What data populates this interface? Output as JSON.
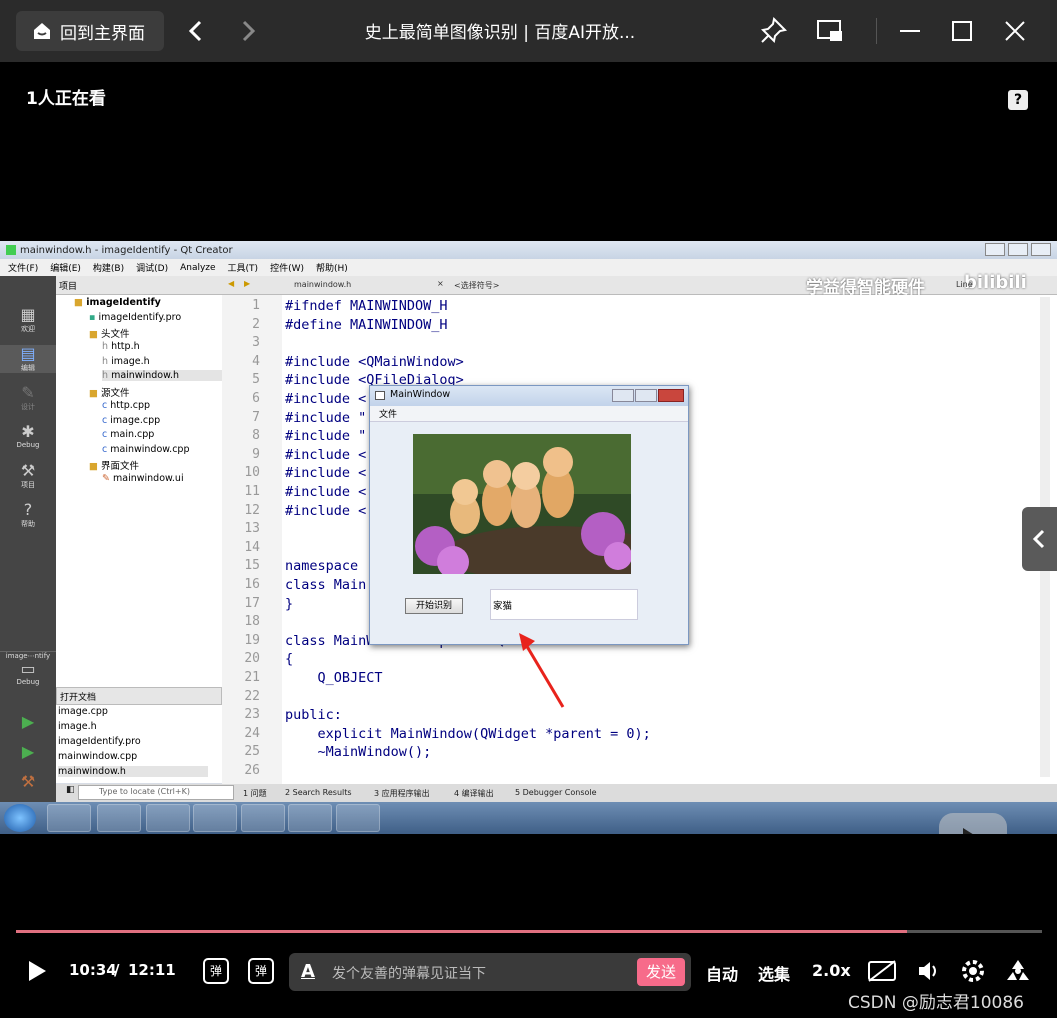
{
  "header": {
    "home_label": "回到主界面",
    "title": "史上最简单图像识别 | 百度AI开放..."
  },
  "viewer_count": "1人正在看",
  "video": {
    "window_title": "mainwindow.h - imageIdentify - Qt Creator",
    "menu": [
      "文件(F)",
      "编辑(E)",
      "构建(B)",
      "调试(D)",
      "Analyze",
      "工具(T)",
      "控件(W)",
      "帮助(H)"
    ],
    "modes": [
      "欢迎",
      "编辑",
      "设计",
      "Debug",
      "项目",
      "帮助"
    ],
    "kit_label": "image⋯ntify",
    "kit_debug": "Debug",
    "project_header": "项目",
    "tree": [
      {
        "label": "imageIdentify",
        "indent": 0,
        "bold": true
      },
      {
        "label": "imageIdentify.pro",
        "indent": 1
      },
      {
        "label": "头文件",
        "indent": 1
      },
      {
        "label": "http.h",
        "indent": 2
      },
      {
        "label": "image.h",
        "indent": 2
      },
      {
        "label": "mainwindow.h",
        "indent": 2
      },
      {
        "label": "源文件",
        "indent": 1
      },
      {
        "label": "http.cpp",
        "indent": 2
      },
      {
        "label": "image.cpp",
        "indent": 2
      },
      {
        "label": "main.cpp",
        "indent": 2
      },
      {
        "label": "mainwindow.cpp",
        "indent": 2
      },
      {
        "label": "界面文件",
        "indent": 1
      },
      {
        "label": "mainwindow.ui",
        "indent": 2
      }
    ],
    "open_docs_header": "打开文档",
    "open_docs": [
      "image.cpp",
      "image.h",
      "imageIdentify.pro",
      "mainwindow.cpp",
      "mainwindow.h"
    ],
    "editor_file": "mainwindow.h",
    "symbol_placeholder": "<选择符号>",
    "watermark": "学益得智能硬件",
    "bilibili": "bilibili",
    "line_hint": "Line",
    "code_lines": [
      {
        "n": "1",
        "t": "#ifndef MAINWINDOW_H"
      },
      {
        "n": "2",
        "t": "#define MAINWINDOW_H"
      },
      {
        "n": "3",
        "t": ""
      },
      {
        "n": "4",
        "t": "#include <QMainWindow>"
      },
      {
        "n": "5",
        "t": "#include <QFileDialog>"
      },
      {
        "n": "6",
        "t": "#include <"
      },
      {
        "n": "7",
        "t": "#include \""
      },
      {
        "n": "8",
        "t": "#include \""
      },
      {
        "n": "9",
        "t": "#include <"
      },
      {
        "n": "10",
        "t": "#include <"
      },
      {
        "n": "11",
        "t": "#include <"
      },
      {
        "n": "12",
        "t": "#include <"
      },
      {
        "n": "13",
        "t": ""
      },
      {
        "n": "14",
        "t": ""
      },
      {
        "n": "15",
        "t": "namespace"
      },
      {
        "n": "16",
        "t": "class Main"
      },
      {
        "n": "17",
        "t": "}"
      },
      {
        "n": "18",
        "t": ""
      },
      {
        "n": "19",
        "t": "class MainWindow : public QMainWindow"
      },
      {
        "n": "20",
        "t": "{"
      },
      {
        "n": "21",
        "t": "    Q_OBJECT"
      },
      {
        "n": "22",
        "t": ""
      },
      {
        "n": "23",
        "t": "public:"
      },
      {
        "n": "24",
        "t": "    explicit MainWindow(QWidget *parent = 0);"
      },
      {
        "n": "25",
        "t": "    ~MainWindow();"
      },
      {
        "n": "26",
        "t": ""
      }
    ],
    "app_window": {
      "title": "MainWindow",
      "menu": "文件",
      "button": "开始识别",
      "result": "家猫"
    },
    "locate_placeholder": "Type to locate (Ctrl+K)",
    "output_tabs": [
      "1 问题",
      "2 Search Results",
      "3 应用程序输出",
      "4 编译输出",
      "5 Debugger Console"
    ]
  },
  "player": {
    "current_time": "10:34",
    "separator": "/",
    "total_time": "12:11",
    "progress": 0.868,
    "danmaku_placeholder": "发个友善的弹幕见证当下",
    "send_label": "发送",
    "auto_label": "自动",
    "episodes_label": "选集",
    "speed_label": "2.0x"
  },
  "footer_credit": "CSDN @励志君10086"
}
